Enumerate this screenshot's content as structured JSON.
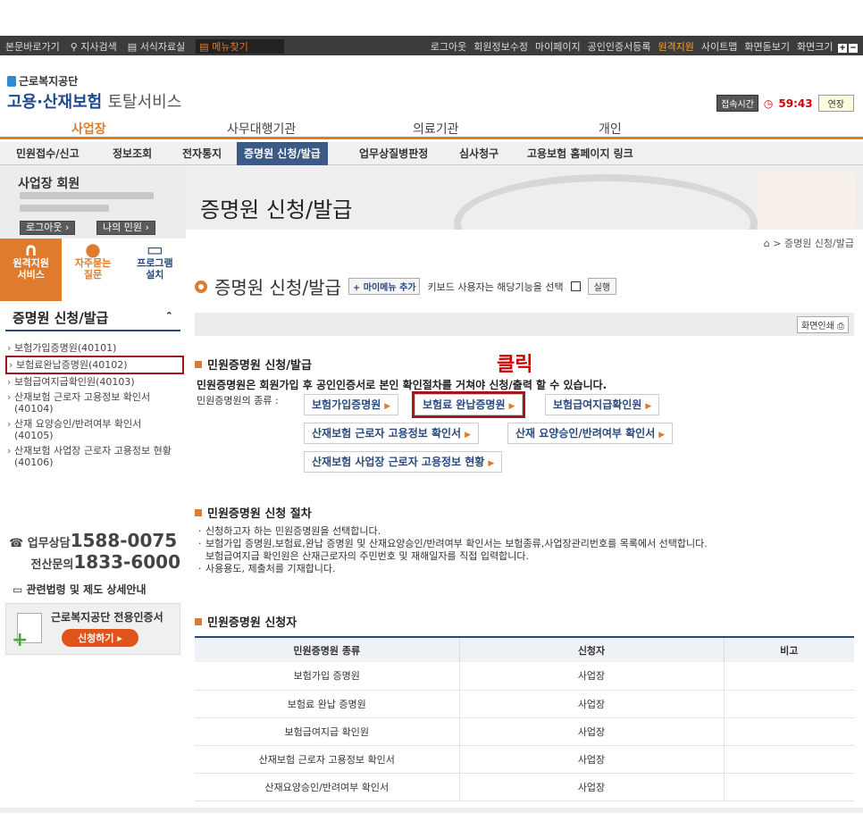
{
  "topbar": {
    "left": [
      "본문바로가기",
      "지사검색",
      "서식자료실",
      "메뉴찾기"
    ],
    "right": [
      "로그아웃",
      "회원정보수정",
      "마이페이지",
      "공인인증서등록",
      "원격지원",
      "사이트맵",
      "화면돋보기",
      "화면크기"
    ]
  },
  "logo": {
    "org": "근로복지공단",
    "main": "고용·산재보험",
    "sub": "토탈서비스"
  },
  "session": {
    "label": "접속시간",
    "time": "59:43",
    "extend": "연장"
  },
  "main_tabs": [
    "사업장",
    "사무대행기관",
    "의료기관",
    "개인"
  ],
  "sub_menu": [
    "민원접수/신고",
    "정보조회",
    "전자통지",
    "증명원 신청/발급",
    "업무상질병판정",
    "심사청구",
    "고용보험 홈페이지 링크"
  ],
  "sidebar": {
    "member_title": "사업장 회원",
    "logout": "로그아웃",
    "my_civil": "나의 민원",
    "quick": [
      {
        "label1": "원격지원",
        "label2": "서비스"
      },
      {
        "label1": "자주묻는",
        "label2": "질문"
      },
      {
        "label1": "프로그램",
        "label2": "설치"
      }
    ],
    "section_title": "증명원 신청/발급",
    "items": [
      "보험가입증명원(40101)",
      "보험료완납증명원(40102)",
      "보험급여지급확인원(40103)",
      "산재보험 근로자 고용정보 확인서 (40104)",
      "산재 요양승인/반려여부 확인서 (40105)",
      "산재보험 사업장 근로자 고용정보 현황(40106)"
    ],
    "phone1_label": "업무상담",
    "phone1": "1588-0075",
    "phone2_label": "전산문의",
    "phone2": "1833-6000",
    "law": "관련법령 및 제도 상세안내",
    "cert_title": "근로복지공단 전용인증서",
    "cert_btn": "신청하기"
  },
  "content": {
    "banner_title": "증명원 신청/발급",
    "breadcrumb": "> 증명원 신청/발급",
    "page_title": "증명원 신청/발급",
    "add_menu": "마이메뉴 추가",
    "keyboard": "키보드 사용자는 해당기능을 선택",
    "run": "실행",
    "print": "화면인쇄",
    "sec1": "민원증명원 신청/발급",
    "click_label": "클릭",
    "desc": "민원증명원은 회원가입 후 공인인증서로 본인 확인절차를 거쳐야 신청/출력 할 수 있습니다.",
    "kinds_label": "민원증명원의 종류 :",
    "buttons": [
      "보험가입증명원",
      "보험료 완납증명원",
      "보험급여지급확인원",
      "산재보험 근로자 고용정보 확인서",
      "산재 요양승인/반려여부 확인서",
      "산재보험 사업장 근로자 고용정보 현황"
    ],
    "sec2": "민원증명원 신청 절차",
    "steps": [
      "신청하고자 하는 민원증명원을 선택합니다.",
      "보험가입 증명원,보험료,완납 증명원 및 산재요양승인/반려여부 확인서는 보험종류,사업장관리번호를 목록에서 선택합니다.",
      "보험급여지급 확인원은 산재근로자의 주민번호 및 재해일자를 직접 입력합니다.",
      "사용용도, 제출처를 기재합니다."
    ],
    "sec3": "민원증명원 신청자",
    "table": {
      "headers": [
        "민원증명원 종류",
        "신청자",
        "비고"
      ],
      "rows": [
        [
          "보험가입 증명원",
          "사업장",
          ""
        ],
        [
          "보험료 완납 증명원",
          "사업장",
          ""
        ],
        [
          "보험급여지급 확인원",
          "사업장",
          ""
        ],
        [
          "산재보험 근로자 고용정보 확인서",
          "사업장",
          ""
        ],
        [
          "산재요양승인/반려여부 확인서",
          "사업장",
          ""
        ]
      ]
    }
  }
}
